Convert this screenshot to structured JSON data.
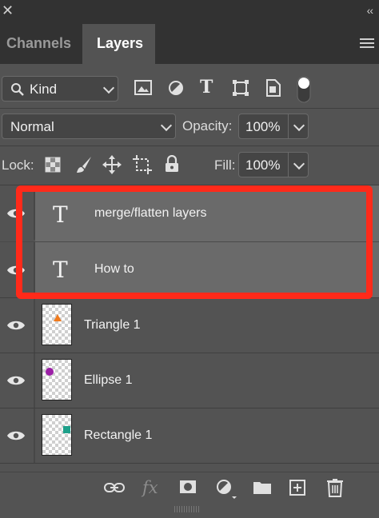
{
  "window": {
    "close_glyph": "✕",
    "collapse_glyph": "‹‹"
  },
  "tabs": [
    {
      "label": "Channels",
      "active": false
    },
    {
      "label": "Layers",
      "active": true
    }
  ],
  "filter": {
    "kind_label": "Kind",
    "filter_icons": [
      "image-filter-icon",
      "adjustment-filter-icon",
      "type-filter-icon",
      "shape-filter-icon",
      "smart-object-filter-icon",
      "filter-toggle-icon"
    ]
  },
  "blend": {
    "mode": "Normal",
    "opacity_label": "Opacity:",
    "opacity_value": "100%"
  },
  "lock": {
    "label": "Lock:",
    "icons": [
      "lock-transparent-icon",
      "lock-image-icon",
      "lock-position-icon",
      "lock-artboard-icon",
      "lock-all-icon"
    ],
    "fill_label": "Fill:",
    "fill_value": "100%"
  },
  "layers": [
    {
      "name": "merge/flatten layers",
      "type": "text",
      "type_glyph": "T"
    },
    {
      "name": "How to",
      "type": "text",
      "type_glyph": "T"
    },
    {
      "name": "Triangle 1",
      "type": "shape",
      "shape": "triangle",
      "color": "#f07a1c"
    },
    {
      "name": "Ellipse 1",
      "type": "shape",
      "shape": "ellipse",
      "color": "#9b1fa6"
    },
    {
      "name": "Rectangle 1",
      "type": "shape",
      "shape": "rectangle",
      "color": "#1ea08a"
    }
  ],
  "footer": {
    "icons": [
      "link-layers-icon",
      "fx-icon",
      "mask-icon",
      "adjustment-icon",
      "folder-icon",
      "new-layer-icon",
      "trash-icon"
    ],
    "fx_label": "fx"
  },
  "colors": {
    "highlight": "#ff2a1a",
    "panel": "#535353",
    "header": "#323232"
  }
}
